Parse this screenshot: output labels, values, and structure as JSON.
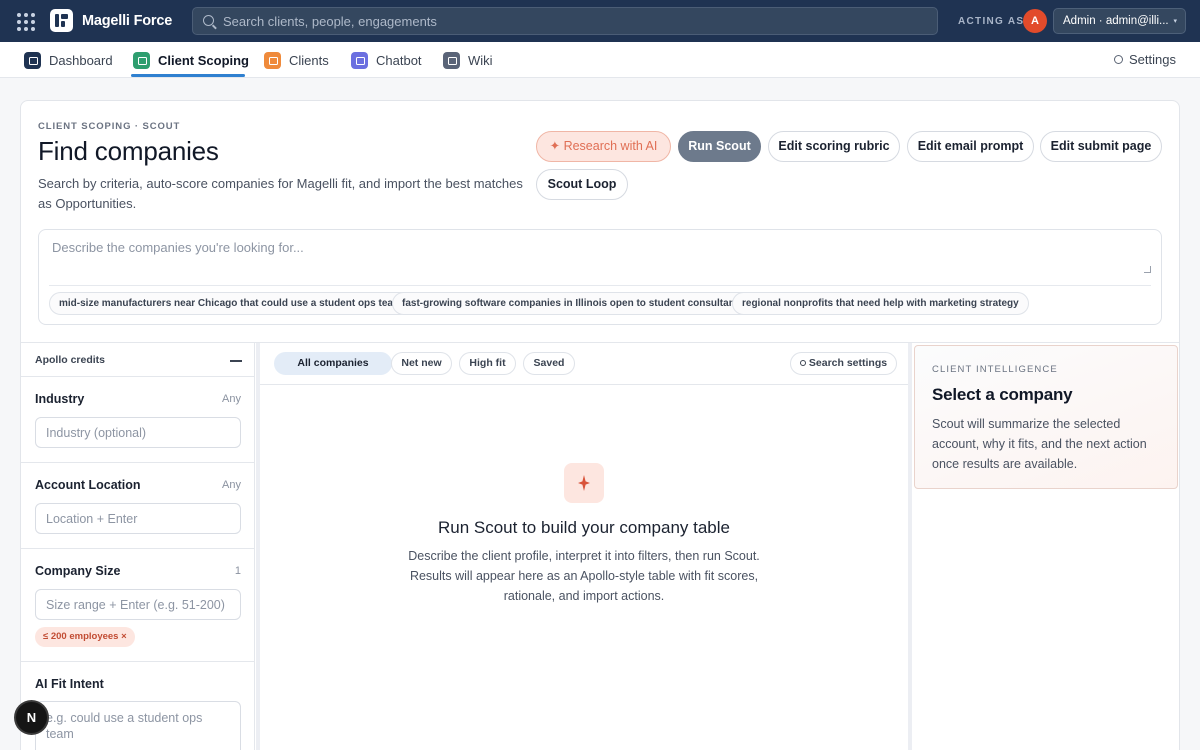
{
  "topbar": {
    "brand": "Magelli Force",
    "search_placeholder": "Search clients, people, engagements",
    "acting_as": "ACTING AS",
    "avatar_initial": "A",
    "account": "Admin · admin@illi...",
    "caret": "▾"
  },
  "nav": {
    "items": [
      {
        "label": "Dashboard",
        "color": "#1f3352"
      },
      {
        "label": "Client Scoping",
        "color": "#2e9e6f"
      },
      {
        "label": "Clients",
        "color": "#ef8a3b"
      },
      {
        "label": "Chatbot",
        "color": "#6b6fe0"
      },
      {
        "label": "Wiki",
        "color": "#5a6478"
      }
    ],
    "active": "Client Scoping",
    "settings": "Settings"
  },
  "header": {
    "crumb": "CLIENT SCOPING · SCOUT",
    "title": "Find companies",
    "subtitle": "Search by criteria, auto-score companies for Magelli fit, and import the best matches as Opportunities."
  },
  "actions": {
    "research": "✦ Research with AI",
    "run": "Run Scout",
    "rubric": "Edit scoring rubric",
    "email": "Edit email prompt",
    "submit": "Edit submit page",
    "loop": "Scout Loop"
  },
  "describe": {
    "placeholder": "Describe the companies you're looking for...",
    "suggestions": [
      "mid-size manufacturers near Chicago that could use a student ops team",
      "fast-growing software companies in Illinois open to student consultants",
      "regional nonprofits that need help with marketing strategy"
    ]
  },
  "filters": {
    "apollo": "Apollo credits",
    "industry": {
      "label": "Industry",
      "badge": "Any",
      "placeholder": "Industry (optional)"
    },
    "location": {
      "label": "Account Location",
      "badge": "Any",
      "placeholder": "Location + Enter"
    },
    "size": {
      "label": "Company Size",
      "badge": "1",
      "placeholder": "Size range + Enter (e.g. 51-200)",
      "tag": "≤ 200 employees ×"
    },
    "intent": {
      "label": "AI Fit Intent",
      "placeholder": "e.g. could use a student ops team"
    }
  },
  "results": {
    "tabs": [
      "All companies",
      "Net new",
      "High fit",
      "Saved"
    ],
    "active_tab": "All companies",
    "search_settings": "Search settings",
    "empty_title": "Run Scout to build your company table",
    "empty_body": "Describe the client profile, interpret it into filters, then run Scout. Results will appear here as an Apollo-style table with fit scores, rationale, and import actions."
  },
  "intel": {
    "kicker": "CLIENT INTELLIGENCE",
    "title": "Select a company",
    "body": "Scout will summarize the selected account, why it fits, and the next action once results are available."
  },
  "badge": "N"
}
